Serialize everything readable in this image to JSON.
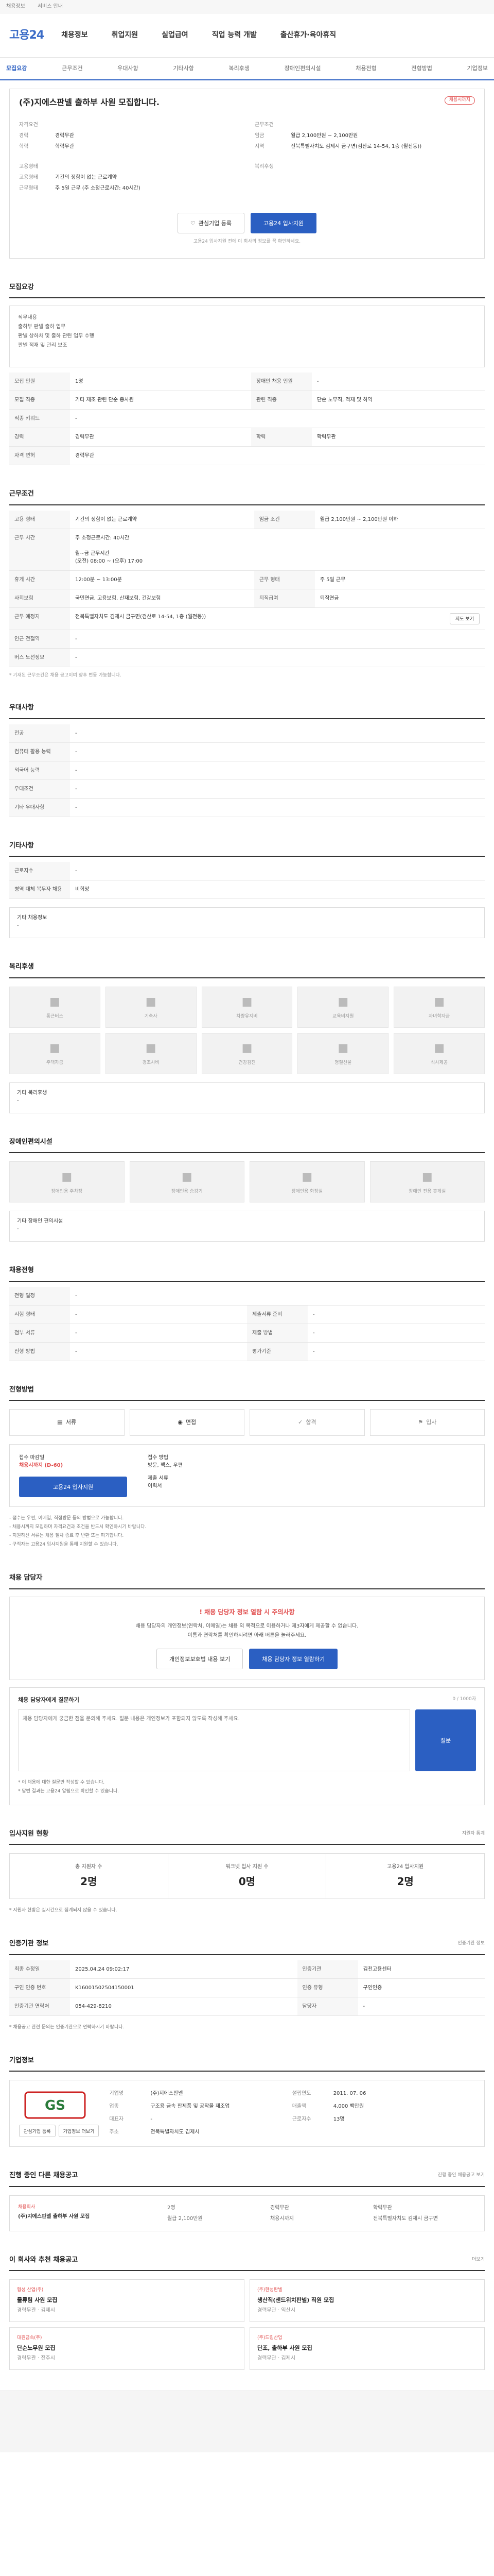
{
  "topbar": {
    "links": [
      "채용정보",
      "서비스 안내"
    ]
  },
  "header": {
    "logo_a": "고용",
    "logo_b": "24",
    "gnb": [
      "채용정보",
      "취업지원",
      "실업급여",
      "직업 능력 개발",
      "출산휴가·육아휴직"
    ]
  },
  "tabs": [
    "모집요강",
    "근무조건",
    "우대사항",
    "기타사항",
    "복리후생",
    "장애인편의시설",
    "채용전형",
    "전형방법",
    "기업정보"
  ],
  "job": {
    "title": "(주)지에스판넬 출하부 사원 모집합니다.",
    "badge": "채용시까지",
    "left_label": "자격요건",
    "left_rows": [
      {
        "k": "경력",
        "v": "경력무관"
      },
      {
        "k": "학력",
        "v": "학력무관"
      }
    ],
    "right_label": "근무조건",
    "right_rows": [
      {
        "k": "임금",
        "v": "월급 2,100만원 ~ 2,100만원"
      },
      {
        "k": "지역",
        "v": "전북특별자치도 김제시 금구면(검산로 14-54, 1층 (월전동))"
      }
    ],
    "left2_label": "고용형태",
    "left2_rows": [
      {
        "k": "고용형태",
        "v": "기간의 정함이 없는 근로계약"
      },
      {
        "k": "근무형태",
        "v": "주 5일 근무 (주 소정근로시간: 40시간)"
      }
    ],
    "right2_label": "복리후생",
    "interest_label": "관심기업 등록",
    "apply_label": "고용24 입사지원",
    "note": "고용24 입사지원 전에 이 회사의 정보를 꼭 확인하세요."
  },
  "recruit": {
    "title": "모집요강",
    "box_label": "직무내용",
    "text": "직무내용\n출하부 판넬 출하 업무\n판넬 상하차 및 출하 관련 업무 수행\n판넬 적재 및 관리 보조"
  },
  "recruit_table": [
    [
      "모집 인원",
      "1명",
      "장애인 채용 인원",
      "-"
    ],
    [
      "모집 직종",
      "기타 제조 관련 단순 종사원",
      "관련 직종",
      "단순 노무직, 적재 및 하역"
    ],
    [
      "직종 키워드",
      "-",
      "",
      ""
    ],
    [
      "경력",
      "경력무관",
      "학력",
      "학력무관"
    ],
    [
      "자격 면허",
      "경력무관",
      "",
      ""
    ]
  ],
  "work": {
    "title": "근무조건",
    "rows": [
      [
        "고용 형태",
        "기간의 정함이 없는 근로계약",
        "임금 조건",
        "월급 2,100만원 ~ 2,100만원 이하"
      ],
      [
        "근무 시간",
        "주 소정근로시간: 40시간\n\n월~금 근무시간\n(오전) 08:00 ~ (오후) 17:00",
        "",
        ""
      ],
      [
        "휴게 시간",
        "12:00분 ~ 13:00분",
        "근무 형태",
        "주 5일 근무"
      ],
      [
        "사회보험",
        "국민연금, 고용보험, 산재보험, 건강보험",
        "퇴직급여",
        "퇴직연금"
      ],
      [
        "근무 예정지",
        "전북특별자치도 김제시 금구면(검산로 14-54, 1층 (월전동))",
        "",
        ""
      ],
      [
        "인근 전철역",
        "-",
        "",
        ""
      ],
      [
        "버스 노선정보",
        "-",
        "",
        ""
      ]
    ],
    "map_btn": "지도 보기",
    "note": "* 기재된 근무조건은 채용 공고이며 향후 변동 가능합니다."
  },
  "prefer": {
    "title": "우대사항",
    "rows": [
      [
        "전공",
        "-"
      ],
      [
        "컴퓨터 활용 능력",
        "-"
      ],
      [
        "외국어 능력",
        "-"
      ],
      [
        "우대조건",
        "-"
      ],
      [
        "기타 우대사항",
        "-"
      ]
    ]
  },
  "etc": {
    "title": "기타사항",
    "rows": [
      [
        "근로자수",
        "-"
      ],
      [
        "병역 대체 복무자 채용",
        "비희망"
      ]
    ],
    "apply_label": "기타 채용정보",
    "apply_value": "-"
  },
  "welfare": {
    "title": "복리후생",
    "items": [
      "통근버스",
      "기숙사",
      "차량유지비",
      "교육비지원",
      "자녀학자금",
      "주택자금",
      "경조사비",
      "건강검진",
      "명절선물",
      "식사제공"
    ],
    "note_label": "기타 복리후생",
    "note_value": "-"
  },
  "facility": {
    "title": "장애인편의시설",
    "items": [
      "장애인용 주차장",
      "장애인용 승강기",
      "장애인용 화장실",
      "장애인 전용 휴게실"
    ],
    "note_label": "기타 장애인 편의시설",
    "note_value": "-"
  },
  "process": {
    "title": "채용전형",
    "rows": [
      [
        "전형 일정",
        "-",
        "",
        ""
      ],
      [
        "시험 형태",
        "-",
        "제출서류 준비",
        "-"
      ],
      [
        "첨부 서류",
        "-",
        "제출 방법",
        "-"
      ],
      [
        "전형 방법",
        "-",
        "평가기준",
        "-"
      ]
    ]
  },
  "method": {
    "title": "전형방법",
    "steps": [
      "서류",
      "면접",
      "합격",
      "입사"
    ],
    "box_left_label": "접수 마감일",
    "box_left_value": "채용시까지 (D-60)",
    "box_mid_label": "접수 방법",
    "box_mid_value": "방문, 팩스, 우편",
    "box_right_label": "제출 서류",
    "box_right_value": "이력서",
    "apply_btn": "고용24 입사지원",
    "list": [
      "- 접수는 우편, 이메일, 직접방문 등의 방법으로 가능합니다.",
      "- 채용시까지 모집하며 자격요건과 조건을 반드시 확인하시기 바랍니다.",
      "- 지원하신 서류는 채용 절차 종료 후 반환 또는 파기합니다.",
      "- 구직자는 고용24 입사지원을 통해 지원할 수 있습니다."
    ]
  },
  "contact": {
    "title": "채용 담당자",
    "warn_title": "채용 담당자 정보 열람 시 주의사항",
    "warn_text": "채용 담당자의 개인정보(연락처, 이메일)는 채용 외 목적으로 이용하거나 제3자에게 제공할 수 없습니다.\n이름과 연락처를 확인하시려면 아래 버튼을 눌러주세요.",
    "btn_a": "개인정보보호법 내용 보기",
    "btn_b": "채용 담당자 정보 열람하기"
  },
  "ask": {
    "title": "채용 담당자에게 질문하기",
    "counter": "0 / 1000자",
    "placeholder": "채용 담당자에게 궁금한 점을 문의해 주세요. 질문 내용은 개인정보가 포함되지 않도록 작성해 주세요.",
    "btn": "질문",
    "notes": [
      "* 이 채용에 대한 질문만 작성할 수 있습니다.",
      "* 답변 결과는 고용24 알림으로 확인할 수 있습니다."
    ]
  },
  "applicants": {
    "title": "입사지원 현황",
    "more": "지원자 통계",
    "stats": [
      {
        "label": "총 지원자 수",
        "value": "2명"
      },
      {
        "label": "워크넷 입사 지원 수",
        "value": "0명"
      },
      {
        "label": "고용24 입사지원",
        "value": "2명"
      }
    ],
    "note": "* 지원자 현황은 실시간으로 집계되지 않을 수 있습니다."
  },
  "auth": {
    "title": "인증기관 정보",
    "more": "인증기관 정보",
    "rows": [
      [
        "최종 수정일",
        "2025.04.24 09:02:17",
        "인증기관",
        "김천고용센터"
      ],
      [
        "구인 인증 번호",
        "K16001502504150001",
        "인증 유형",
        "구인인증"
      ],
      [
        "인증기관 연락처",
        "054-429-8210",
        "담당자",
        "-"
      ]
    ],
    "note": "* 채용공고 관련 문의는 인증기관으로 연락하시기 바랍니다."
  },
  "company": {
    "title": "기업정보",
    "logo": "GS",
    "logo_sub": "지에스판넬",
    "btn_a": "관심기업 등록",
    "btn_b": "기업정보 더보기",
    "rows": [
      [
        "기업명",
        "(주)지에스판넬",
        "설립연도",
        "2011. 07. 06"
      ],
      [
        "업종",
        "구조용 금속 판제품 및 공작물 제조업",
        "매출액",
        "4,000 백만원"
      ],
      [
        "대표자",
        "-",
        "근로자수",
        "13명"
      ],
      [
        "주소",
        "전북특별자치도 김제시",
        "",
        ""
      ]
    ]
  },
  "other": {
    "title": "진행 중인 다른 채용공고",
    "more": "진행 중인 채용공고 보기",
    "co": "채용회사",
    "name": "(주)지에스판넬 출하부 사원 모집",
    "meta": [
      "2명",
      "경력무관",
      "학력무관",
      "월급 2,100만원",
      "채용시까지",
      "전북특별자치도 김제시 금구면"
    ]
  },
  "rec": {
    "title": "이 회사와 추천 채용공고",
    "more": "더보기",
    "items": [
      {
        "co": "협성 산업(주)",
        "t": "물류팀 사원 모집",
        "m": "경력무관 · 김제시"
      },
      {
        "co": "(주)한성판넬",
        "t": "생산직(샌드위치판넬) 직원 모집",
        "m": "경력무관 · 익산시"
      },
      {
        "co": "대원금속(주)",
        "t": "단순노무원 모집",
        "m": "경력무관 · 전주시"
      },
      {
        "co": "(주)드림산업",
        "t": "단조, 출하부 사원 모집",
        "m": "경력무관 · 김제시"
      }
    ]
  },
  "colors": {
    "accent": "#2b5fc2",
    "warn": "#e04b4b"
  }
}
